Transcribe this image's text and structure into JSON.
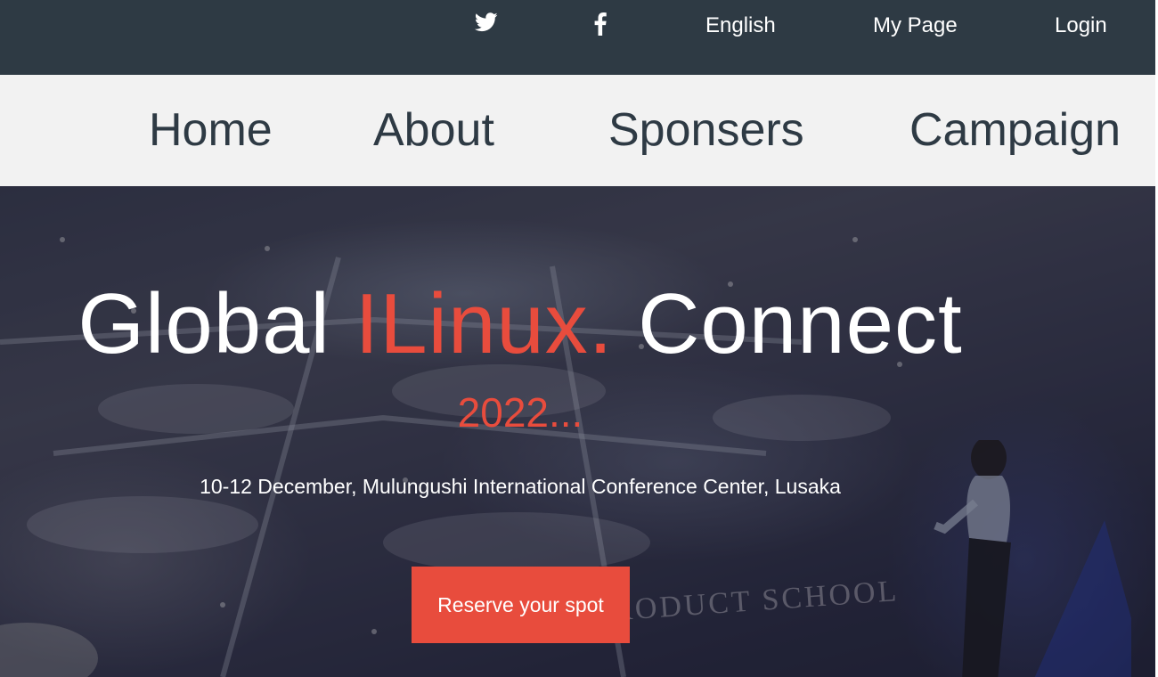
{
  "topbar": {
    "twitter_icon": "twitter-icon",
    "facebook_icon": "facebook-icon",
    "language": "English",
    "my_page": "My Page",
    "login": "Login"
  },
  "nav": {
    "items": [
      {
        "label": "Home"
      },
      {
        "label": "About"
      },
      {
        "label": "Sponsers"
      },
      {
        "label": "Campaign"
      }
    ]
  },
  "hero": {
    "title_part1": "Global",
    "title_accent": "ILinux.",
    "title_part2": "Connect",
    "year": "2022...",
    "subtitle": "10-12 December, Mulungushi International Conference Center, Lusaka",
    "cta_label": "Reserve your spot",
    "background_signage": "PRODUCT SCHOOL"
  },
  "colors": {
    "topbar_bg": "#2e3a44",
    "navbar_bg": "#f2f2f2",
    "nav_text": "#2e3a44",
    "accent": "#e84c3d",
    "white": "#ffffff"
  }
}
